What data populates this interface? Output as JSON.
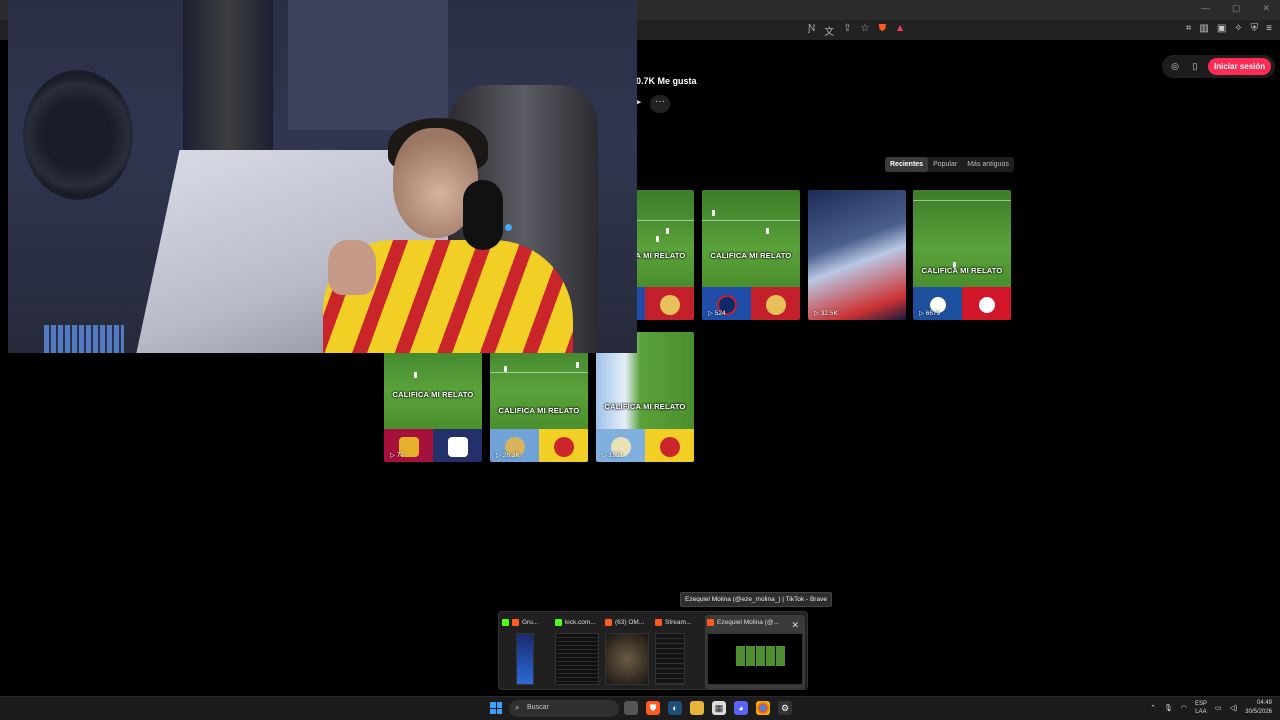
{
  "browser": {
    "win_controls": [
      "—",
      "▢",
      "✕"
    ]
  },
  "profile": {
    "likes_text": "0.7K Me gusta",
    "more_label": "···",
    "login_label": "Iniciar sesión"
  },
  "sort_tabs": [
    {
      "label": "Recientes",
      "active": true
    },
    {
      "label": "Popular",
      "active": false
    },
    {
      "label": "Más antiguos",
      "active": false
    }
  ],
  "videos_row1": [
    {
      "caption": "CALIFICA MI RELATO",
      "views": ""
    },
    {
      "caption": "CALIFICA MI RELATO",
      "views": "▷ 524"
    },
    {
      "caption": "",
      "views": "▷ 32.5K"
    },
    {
      "caption": "CALIFICA MI RELATO",
      "views": "▷ 6679"
    }
  ],
  "videos_row2": [
    {
      "caption": "CALIFICA MI RELATO",
      "views": "▷ 77"
    },
    {
      "caption": "CALIFICA MI RELATO",
      "views": "▷ 26.3K"
    },
    {
      "caption": "CALIFICA MI RELATO",
      "views": "▷ 1851"
    }
  ],
  "tooltip": "Ezequiel Molina (@eze_molina_) | TikTok - Brave",
  "switcher": [
    {
      "title": "Gru...",
      "app": "kick"
    },
    {
      "title": "kick.com...",
      "app": "kick"
    },
    {
      "title": "(63) OM...",
      "app": "brave"
    },
    {
      "title": "Stream...",
      "app": "brave"
    },
    {
      "title": "Ezequiel Molina (@...",
      "app": "brave"
    }
  ],
  "taskbar": {
    "search_label": "Buscar",
    "lang_line1": "ESP",
    "lang_line2": "LAA",
    "time": "04:49",
    "date": "30/5/2026"
  },
  "colors": {
    "accent": "#fe2c55",
    "brave": "#ff5a1f",
    "kick": "#53fc18"
  }
}
